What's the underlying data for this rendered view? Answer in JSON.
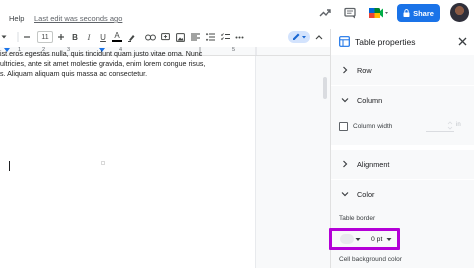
{
  "topbar": {
    "help_label": "Help",
    "last_edit": "Last edit was seconds ago",
    "share_label": "Share"
  },
  "toolbar": {
    "font_size": "11"
  },
  "ruler": {
    "numbers": [
      "1",
      "2",
      "3",
      "4",
      "5"
    ]
  },
  "document": {
    "lines": [
      "ist eros egestas nulla, quis tincidunt quam justo vitae orna. Nunc",
      "ultricies, ante sit amet molestie gravida, enim lorem congue risus,",
      "s. Aliquam aliquam quis massa ac consectetur."
    ]
  },
  "panel": {
    "title": "Table properties",
    "sections": {
      "row": "Row",
      "column": "Column",
      "alignment": "Alignment",
      "color": "Color"
    },
    "column_width_label": "Column width",
    "column_width_unit": "in",
    "table_border_label": "Table border",
    "border_width_value": "0 pt",
    "cell_background_label": "Cell background color"
  },
  "colors": {
    "accent": "#1a73e8",
    "highlight": "#b400d7"
  }
}
